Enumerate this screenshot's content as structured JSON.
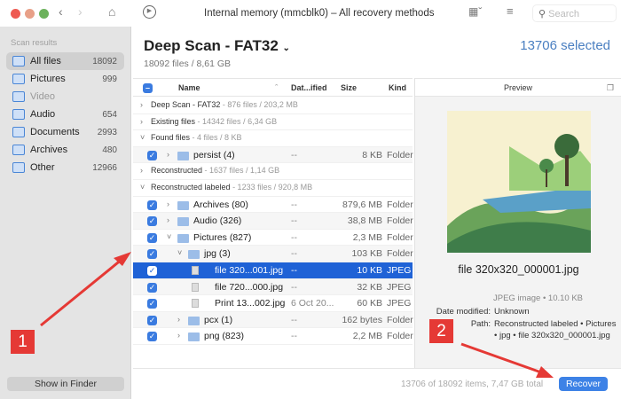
{
  "window": {
    "title": "Internal memory (mmcblk0) – All recovery methods",
    "search_placeholder": "Search"
  },
  "sidebar": {
    "heading": "Scan results",
    "items": [
      {
        "label": "All files",
        "count": "18092",
        "active": true
      },
      {
        "label": "Pictures",
        "count": "999"
      },
      {
        "label": "Video",
        "count": "",
        "dim": true
      },
      {
        "label": "Audio",
        "count": "654"
      },
      {
        "label": "Documents",
        "count": "2993"
      },
      {
        "label": "Archives",
        "count": "480"
      },
      {
        "label": "Other",
        "count": "12966"
      }
    ],
    "show_in_finder": "Show in Finder"
  },
  "main": {
    "title": "Deep Scan - FAT32",
    "subtitle": "18092 files / 8,61 GB",
    "selected": "13706 selected",
    "columns": {
      "name": "Name",
      "date": "Dat...ified",
      "size": "Size",
      "kind": "Kind"
    },
    "rows": [
      {
        "type": "group",
        "expanded": false,
        "label": "Deep Scan - FAT32",
        "meta": " - 876 files / 203,2 MB"
      },
      {
        "type": "group",
        "expanded": false,
        "label": "Existing files",
        "meta": " - 14342 files / 6,34 GB"
      },
      {
        "type": "group",
        "expanded": true,
        "label": "Found files",
        "meta": " - 4 files / 8 KB"
      },
      {
        "type": "folder",
        "level": 0,
        "expanded": false,
        "name": "persist (4)",
        "date": "--",
        "size": "8 KB",
        "kind": "Folder",
        "checked": true
      },
      {
        "type": "group",
        "expanded": false,
        "label": "Reconstructed",
        "meta": " - 1637 files / 1,14 GB"
      },
      {
        "type": "group",
        "expanded": true,
        "label": "Reconstructed labeled",
        "meta": " - 1233 files / 920,8 MB"
      },
      {
        "type": "folder",
        "level": 0,
        "expanded": false,
        "name": "Archives (80)",
        "date": "--",
        "size": "879,6 MB",
        "kind": "Folder",
        "checked": true
      },
      {
        "type": "folder",
        "level": 0,
        "expanded": false,
        "name": "Audio (326)",
        "date": "--",
        "size": "38,8 MB",
        "kind": "Folder",
        "checked": true
      },
      {
        "type": "folder",
        "level": 0,
        "expanded": true,
        "name": "Pictures (827)",
        "date": "--",
        "size": "2,3 MB",
        "kind": "Folder",
        "checked": true
      },
      {
        "type": "folder",
        "level": 1,
        "expanded": true,
        "name": "jpg (3)",
        "date": "--",
        "size": "103 KB",
        "kind": "Folder",
        "checked": true
      },
      {
        "type": "file",
        "level": 2,
        "name": "file 320...001.jpg",
        "date": "--",
        "size": "10 KB",
        "kind": "JPEG i",
        "checked": true,
        "selected": true
      },
      {
        "type": "file",
        "level": 2,
        "name": "file 720...000.jpg",
        "date": "--",
        "size": "32 KB",
        "kind": "JPEG i",
        "checked": true
      },
      {
        "type": "file",
        "level": 2,
        "name": "Print 13...002.jpg",
        "date": "6 Oct 20...",
        "size": "60 KB",
        "kind": "JPEG i",
        "checked": true
      },
      {
        "type": "folder",
        "level": 1,
        "expanded": false,
        "name": "pcx (1)",
        "date": "--",
        "size": "162 bytes",
        "kind": "Folder",
        "checked": true
      },
      {
        "type": "folder",
        "level": 1,
        "expanded": false,
        "name": "png (823)",
        "date": "--",
        "size": "2,2 MB",
        "kind": "Folder",
        "checked": true
      }
    ]
  },
  "preview": {
    "heading": "Preview",
    "file_name": "file 320x320_000001.jpg",
    "type_size": "JPEG image • 10.10 KB",
    "date_label": "Date modified:",
    "date_value": "Unknown",
    "path_label": "Path:",
    "path_value": "Reconstructed labeled • Pictures • jpg • file 320x320_000001.jpg"
  },
  "footer": {
    "status": "13706 of 18092 items, 7,47 GB total",
    "recover": "Recover"
  },
  "annotations": [
    {
      "label": "1"
    },
    {
      "label": "2"
    }
  ],
  "colors": {
    "accent": "#3d82e6",
    "selection": "#1f62d6",
    "annotation": "#e53935"
  }
}
